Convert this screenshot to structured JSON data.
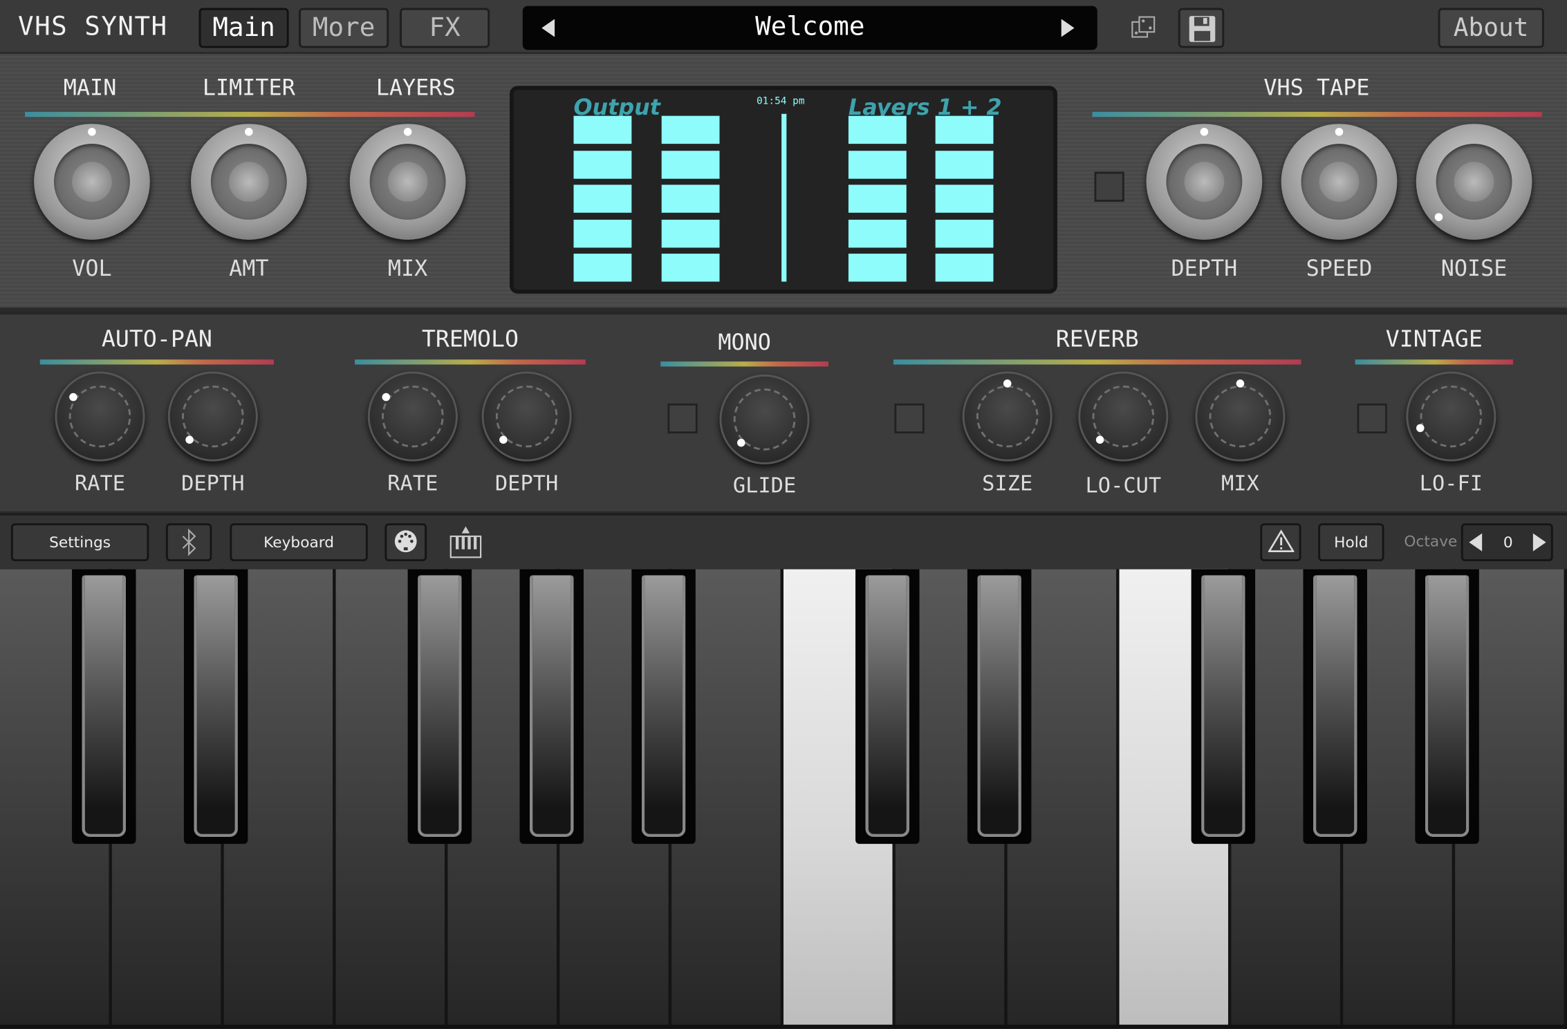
{
  "header": {
    "app_title": "VHS SYNTH",
    "tabs": [
      {
        "label": "Main",
        "active": true
      },
      {
        "label": "More",
        "active": false
      },
      {
        "label": "FX",
        "active": false
      }
    ],
    "preset_name": "Welcome",
    "about_label": "About",
    "icons": [
      "prev-preset-icon",
      "next-preset-icon",
      "dice-randomize-icon",
      "save-floppy-icon"
    ]
  },
  "main_section": {
    "headers": [
      "MAIN",
      "LIMITER",
      "LAYERS"
    ],
    "knobs": [
      {
        "label": "VOL",
        "value": 0.5
      },
      {
        "label": "AMT",
        "value": 0.5
      },
      {
        "label": "MIX",
        "value": 0.5
      }
    ]
  },
  "display": {
    "output_label": "Output",
    "layers_label": "Layers 1 + 2",
    "time": "01:54 pm",
    "meter_levels": [
      1,
      1,
      1,
      1
    ],
    "accent": "#8ffcfc"
  },
  "vhs_tape": {
    "header": "VHS TAPE",
    "enabled": false,
    "knobs": [
      {
        "label": "DEPTH",
        "value": 0.5
      },
      {
        "label": "SPEED",
        "value": 0.5
      },
      {
        "label": "NOISE",
        "value": 0.0
      }
    ]
  },
  "fx": {
    "auto_pan": {
      "header": "AUTO-PAN",
      "knobs": [
        {
          "label": "RATE",
          "value": 0.3
        },
        {
          "label": "DEPTH",
          "value": 0.0
        }
      ]
    },
    "tremolo": {
      "header": "TREMOLO",
      "knobs": [
        {
          "label": "RATE",
          "value": 0.3
        },
        {
          "label": "DEPTH",
          "value": 0.0
        }
      ]
    },
    "mono": {
      "header": "MONO",
      "enabled": false,
      "knobs": [
        {
          "label": "GLIDE",
          "value": 0.0
        }
      ]
    },
    "reverb": {
      "header": "REVERB",
      "enabled": false,
      "knobs": [
        {
          "label": "SIZE",
          "value": 0.5
        },
        {
          "label": "LO-CUT",
          "value": 0.0
        },
        {
          "label": "MIX",
          "value": 0.5
        }
      ]
    },
    "vintage": {
      "header": "VINTAGE",
      "enabled": false,
      "knobs": [
        {
          "label": "LO-FI",
          "value": 0.09
        }
      ]
    }
  },
  "toolbar": {
    "settings_label": "Settings",
    "keyboard_label": "Keyboard",
    "hold_label": "Hold",
    "octave_label": "Octave",
    "octave_value": "0",
    "icons": [
      "bluetooth-icon",
      "midi-icon",
      "keyboard-config-icon",
      "warning-icon"
    ]
  },
  "keyboard": {
    "white_keys": 14,
    "pressed_white_keys": [
      7,
      10
    ]
  }
}
